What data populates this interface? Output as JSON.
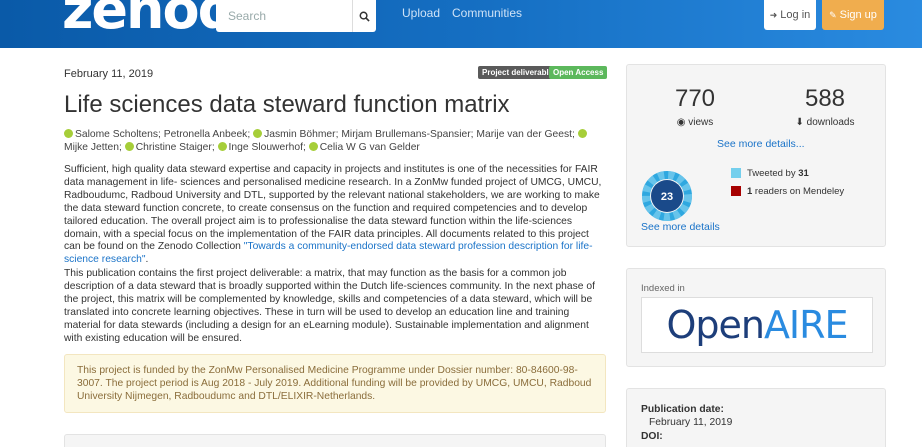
{
  "header": {
    "logo": "zenodo",
    "search_placeholder": "Search",
    "nav": [
      "Upload",
      "Communities"
    ],
    "login_label": "Log in",
    "signup_label": "Sign up"
  },
  "record": {
    "date": "February 11, 2019",
    "badges": [
      {
        "label": "Project deliverable",
        "color": "#5a5a5a"
      },
      {
        "label": "Open Access",
        "color": "#5cb85c"
      }
    ],
    "title": "Life sciences data steward function matrix",
    "authors": [
      {
        "name": "Salome Scholtens",
        "orcid": true
      },
      {
        "name": "Petronella Anbeek",
        "orcid": false
      },
      {
        "name": "Jasmin Böhmer",
        "orcid": true
      },
      {
        "name": "Mirjam Brullemans-Spansier",
        "orcid": false
      },
      {
        "name": "Marije van der Geest",
        "orcid": false
      },
      {
        "name": "Mijke Jetten",
        "orcid": true
      },
      {
        "name": "Christine Staiger",
        "orcid": true
      },
      {
        "name": "Inge Slouwerhof",
        "orcid": true
      },
      {
        "name": "Celia W G van Gelder",
        "orcid": true
      }
    ],
    "description_1": "Sufficient, high quality data steward expertise and capacity in projects and institutes is one of the necessities for FAIR data management in life- sciences and personalised medicine research. In a ZonMw funded project of UMCG, UMCU, Radboudumc, Radboud University and DTL, supported by the relevant national stakeholders, we are working to make the data steward function concrete, to create consensus on the function and required competencies and to develop tailored education. The overall project aim is to professionalise the data steward function within the life-sciences domain, with a special focus on the implementation of the FAIR data principles. All documents related to this project can be found on the Zenodo Collection ",
    "description_1_link": "\"Towards a community-endorsed data steward profession description for life-science research\"",
    "description_1_end": ".",
    "description_2": "This publication contains the first project deliverable: a matrix, that may function as the basis for a common job description of a data steward that is broadly supported within the Dutch life-sciences community. In the next phase of the project, this matrix will be complemented by knowledge, skills and competencies of a data steward, which will be translated into concrete learning objectives. These in turn will be used to develop an education line and training material for data stewards (including a design for an eLearning module). Sustainable implementation and alignment with existing education will be ensured.",
    "funding": "This project is funded by the ZonMw Personalised Medicine Programme under Dossier number: 80-84600-98-3007. The project period is Aug 2018 - July 2019. Additional funding will be provided by UMCG, UMCU, Radboud University Nijmegen, Radboudumc and DTL/ELIXIR-Netherlands."
  },
  "stats": {
    "views": "770",
    "views_label": "views",
    "downloads": "588",
    "downloads_label": "downloads",
    "see_more": "See more details...",
    "altmetric_score": "23",
    "tweeted_prefix": "Tweeted by ",
    "tweeted_count": "31",
    "mendeley_count": "1",
    "mendeley_suffix": " readers on Mendeley",
    "see_more_altmetric": "See more details",
    "colors": {
      "twitter": "#74cfed",
      "mendeley": "#a60000",
      "ring": "#2fa8e0"
    }
  },
  "indexed": {
    "label": "Indexed in",
    "logo_open": "Open",
    "logo_aire": "AIRE",
    "colors": {
      "open": "#1d3e7a",
      "aire": "#2a8be0"
    }
  },
  "publication": {
    "date_label": "Publication date:",
    "date_value": "February 11, 2019",
    "doi_label": "DOI:"
  }
}
